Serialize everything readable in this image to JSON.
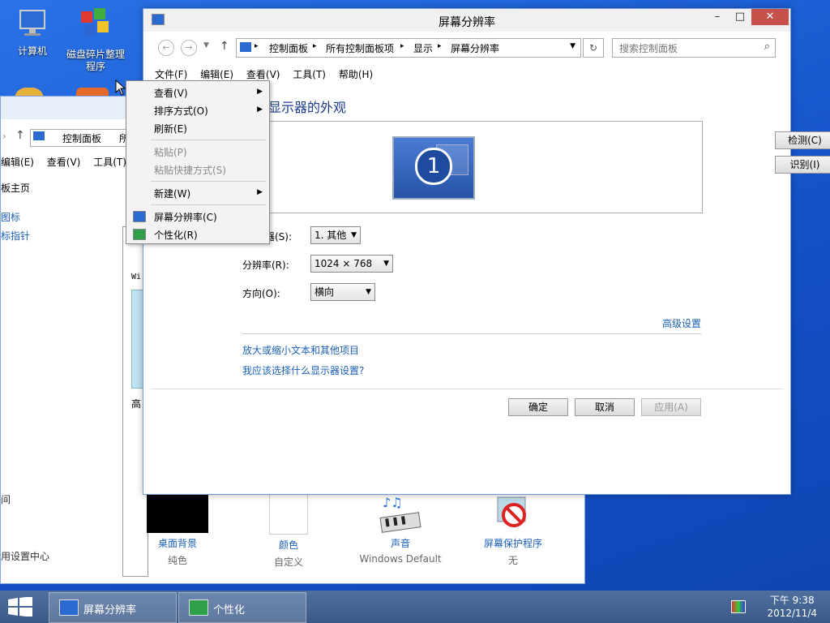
{
  "desktop": {
    "icons": [
      {
        "label": "计算机",
        "icon": "computer-icon"
      },
      {
        "label": "磁盘碎片整理程序",
        "icon": "defrag-icon"
      }
    ]
  },
  "bg_window": {
    "address_parts": [
      "控制面板",
      "所"
    ],
    "menu": [
      "编辑(E)",
      "查看(V)",
      "工具(T)"
    ],
    "left_links": [
      "板主页",
      "图标",
      "标指针",
      "间",
      "用设置中心"
    ],
    "preview_text_1": "Wi",
    "preview_text_2": "高"
  },
  "main_window": {
    "title": "屏幕分辨率",
    "controls": {
      "minimize": "–",
      "maximize": "□",
      "close": "✕"
    },
    "breadcrumb": [
      "控制面板",
      "所有控制面板项",
      "显示",
      "屏幕分辨率"
    ],
    "search_placeholder": "搜索控制面板",
    "menu": [
      "文件(F)",
      "编辑(E)",
      "查看(V)",
      "工具(T)",
      "帮助(H)"
    ],
    "heading": "显示器的外观",
    "monitor_number": "1",
    "detect_button": "检测(C)",
    "identify_button": "识别(I)",
    "display_label": "器(S):",
    "display_value": "1. 其他",
    "resolution_label": "分辨率(R):",
    "resolution_value": "1024 × 768",
    "orientation_label": "方向(O):",
    "orientation_value": "横向",
    "advanced_link": "高级设置",
    "link_text_size": "放大或缩小文本和其他项目",
    "link_which_settings": "我应该选择什么显示器设置?",
    "ok_button": "确定",
    "cancel_button": "取消",
    "apply_button": "应用(A)"
  },
  "context_menu": {
    "items": [
      {
        "label": "查看(V)",
        "submenu": true,
        "enabled": true
      },
      {
        "label": "排序方式(O)",
        "submenu": true,
        "enabled": true
      },
      {
        "label": "刷新(E)",
        "submenu": false,
        "enabled": true
      },
      {
        "label": "粘贴(P)",
        "submenu": false,
        "enabled": false
      },
      {
        "label": "粘贴快捷方式(S)",
        "submenu": false,
        "enabled": false
      },
      {
        "label": "新建(W)",
        "submenu": true,
        "enabled": true
      },
      {
        "label": "屏幕分辨率(C)",
        "submenu": false,
        "enabled": true
      },
      {
        "label": "个性化(R)",
        "submenu": false,
        "enabled": true
      }
    ]
  },
  "tiles": [
    {
      "caption": "桌面背景",
      "sub": "纯色"
    },
    {
      "caption": "颜色",
      "sub": "自定义"
    },
    {
      "caption": "声音",
      "sub": "Windows Default"
    },
    {
      "caption": "屏幕保护程序",
      "sub": "无"
    }
  ],
  "taskbar": {
    "buttons": [
      "屏幕分辨率",
      "个性化"
    ],
    "time": "下午 9:38",
    "date": "2012/11/4"
  },
  "colors": {
    "accent": "#1a5fb4",
    "desktop": "#1452c8",
    "taskbar": "#3c5a88",
    "close": "#c7504a"
  }
}
